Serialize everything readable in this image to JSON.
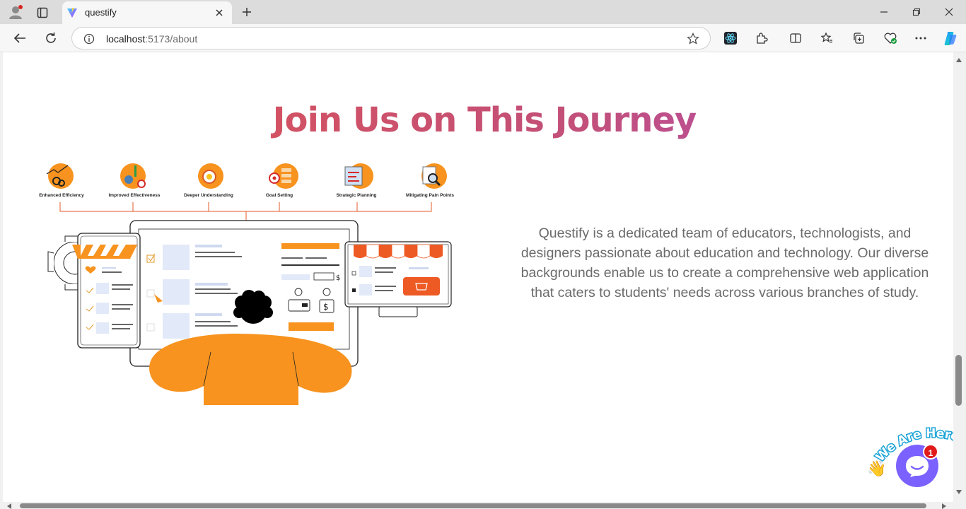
{
  "browser": {
    "tab_title": "questify",
    "url_host": "localhost",
    "url_rest": ":5173/about"
  },
  "page": {
    "heading": "Join Us on This Journey",
    "description": "Questify is a dedicated team of educators, technologists, and designers passionate about education and technology. Our diverse backgrounds enable us to create a comprehensive web application that caters to students' needs across various branches of study.",
    "features": [
      "Enhanced Efficiency",
      "Improved Effectiveness",
      "Deeper Understanding",
      "Goal Setting",
      "Strategic Planning",
      "Mitigating Pain Points"
    ]
  },
  "chat_widget": {
    "tagline": "We Are Here!",
    "badge_count": "1"
  },
  "colors": {
    "accent_orange": "#f7931e",
    "heading_start": "#e0534f",
    "heading_end": "#b04cc0",
    "chat_purple": "#7b61ff",
    "store_red": "#ee5a24"
  }
}
